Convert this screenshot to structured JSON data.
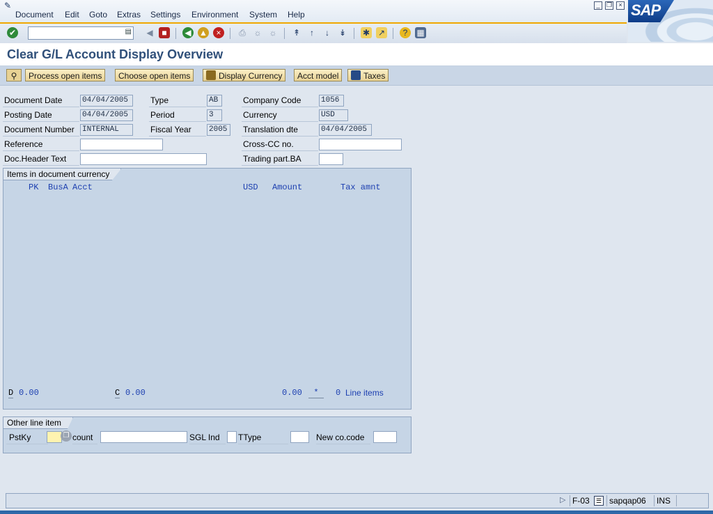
{
  "menu": [
    "Document",
    "Edit",
    "Goto",
    "Extras",
    "Settings",
    "Environment",
    "System",
    "Help"
  ],
  "menu_underline": [
    "D",
    "E",
    "G",
    "x",
    "S",
    "v",
    "S",
    "H"
  ],
  "brand": "SAP",
  "window_controls": [
    "minimize-icon",
    "restore-icon",
    "close-icon"
  ],
  "toolbar": {
    "command_value": "",
    "icons": [
      "enter-icon",
      "back-arrow-icon",
      "save-icon",
      "back-icon",
      "exit-icon",
      "cancel-icon",
      "print-icon",
      "find-icon",
      "find-next-icon",
      "first-page-icon",
      "previous-page-icon",
      "next-page-icon",
      "last-page-icon",
      "create-session-icon",
      "shortcut-icon",
      "help-icon",
      "layout-menu-icon"
    ]
  },
  "title": "Clear G/L Account Display Overview",
  "app_buttons": {
    "process_open_items": "Process open items",
    "choose_open_items": "Choose open items",
    "display_currency": "Display Currency",
    "acct_model": "Acct model",
    "taxes": "Taxes"
  },
  "header": {
    "document_date": {
      "label": "Document Date",
      "value": "04/04/2005"
    },
    "posting_date": {
      "label": "Posting Date",
      "value": "04/04/2005"
    },
    "document_number": {
      "label": "Document Number",
      "value": "INTERNAL"
    },
    "reference": {
      "label": "Reference",
      "value": ""
    },
    "doc_header_text": {
      "label": "Doc.Header Text",
      "value": ""
    },
    "type": {
      "label": "Type",
      "value": "AB"
    },
    "period": {
      "label": "Period",
      "value": "3"
    },
    "fiscal_year": {
      "label": "Fiscal Year",
      "value": "2005"
    },
    "company_code": {
      "label": "Company Code",
      "value": "1056"
    },
    "currency": {
      "label": "Currency",
      "value": "USD"
    },
    "translation_dte": {
      "label": "Translation dte",
      "value": "04/04/2005"
    },
    "cross_cc_no": {
      "label": "Cross-CC no.",
      "value": ""
    },
    "trading_part_ba": {
      "label": "Trading part.BA",
      "value": ""
    }
  },
  "items": {
    "group_title": "Items in document currency",
    "columns": {
      "pk": "PK",
      "busa": "BusA",
      "acct": "Acct",
      "usd": "USD",
      "amount": "Amount",
      "tax": "Tax amnt"
    },
    "totals": {
      "d_label": "D",
      "d_value": "0.00",
      "c_label": "C",
      "c_value": "0.00",
      "balance": "0.00",
      "marker": "*",
      "line_count": "0",
      "line_items_label": "Line items"
    }
  },
  "other_line": {
    "group_title": "Other line item",
    "pstky_label": "PstKy",
    "pstky_value": "",
    "account_label": "count",
    "account_value": "",
    "sgl_label": "SGL Ind",
    "sgl_value": "",
    "ttype_label": "TType",
    "ttype_value": "",
    "new_cocode_label": "New co.code",
    "new_cocode_value": ""
  },
  "status": {
    "transaction": "F-03",
    "server": "sapqap06",
    "mode": "INS"
  }
}
